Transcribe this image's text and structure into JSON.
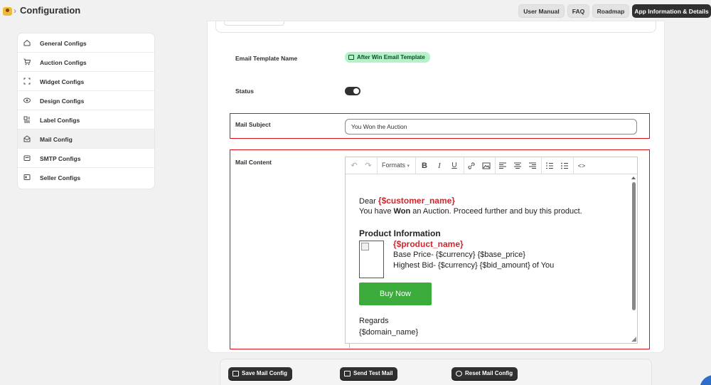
{
  "header": {
    "title": "Configuration",
    "breadcrumb_separator": "›",
    "buttons": [
      {
        "label": "User Manual"
      },
      {
        "label": "FAQ"
      },
      {
        "label": "Roadmap"
      },
      {
        "label": "App Information & Details"
      }
    ]
  },
  "sidebar": {
    "items": [
      {
        "label": "General Configs",
        "icon": "home-icon"
      },
      {
        "label": "Auction Configs",
        "icon": "cart-icon"
      },
      {
        "label": "Widget Configs",
        "icon": "widget-frame-icon"
      },
      {
        "label": "Design Configs",
        "icon": "eye-icon"
      },
      {
        "label": "Label Configs",
        "icon": "label-icon"
      },
      {
        "label": "Mail Config",
        "icon": "mail-open-icon",
        "active": true
      },
      {
        "label": "SMTP Configs",
        "icon": "mail-icon"
      },
      {
        "label": "Seller Configs",
        "icon": "seller-card-icon"
      }
    ]
  },
  "form": {
    "template_name_label": "Email Template Name",
    "template_name_value": "After Win Email Template",
    "status_label": "Status",
    "status_on": true,
    "subject_label": "Mail Subject",
    "subject_value": "You Won the Auction",
    "content_label": "Mail Content"
  },
  "editor": {
    "toolbar": {
      "formats_label": "Formats",
      "tools": [
        "undo-icon",
        "redo-icon",
        "bold-icon",
        "italic-icon",
        "underline-icon",
        "link-icon",
        "image-icon",
        "align-left-icon",
        "align-center-icon",
        "align-right-icon",
        "numbered-list-icon",
        "bullet-list-icon",
        "source-code-icon"
      ]
    },
    "body": {
      "greeting": "Dear",
      "customer_var": "{$customer_name}",
      "line1_pre": "You have",
      "line1_bold": "Won",
      "line1_post": "an Auction. Proceed further and buy this product.",
      "section_title": "Product Information",
      "product_var": "{$product_name}",
      "base_price": "Base Price- {$currency} {$base_price}",
      "highest_bid": "Highest Bid- {$currency} {$bid_amount} of You",
      "buy_button": "Buy Now",
      "regards": "Regards",
      "domain": "{$domain_name}"
    }
  },
  "actions": {
    "save": "Save Mail Config",
    "test": "Send Test Mail",
    "reset": "Reset Mail Config"
  },
  "colors": {
    "dark_button": "#303030",
    "highlight_border": "#e0101a",
    "tag_bg": "#b4f3c8",
    "variable_text": "#d0262c",
    "buy_button": "#3bab3b"
  }
}
